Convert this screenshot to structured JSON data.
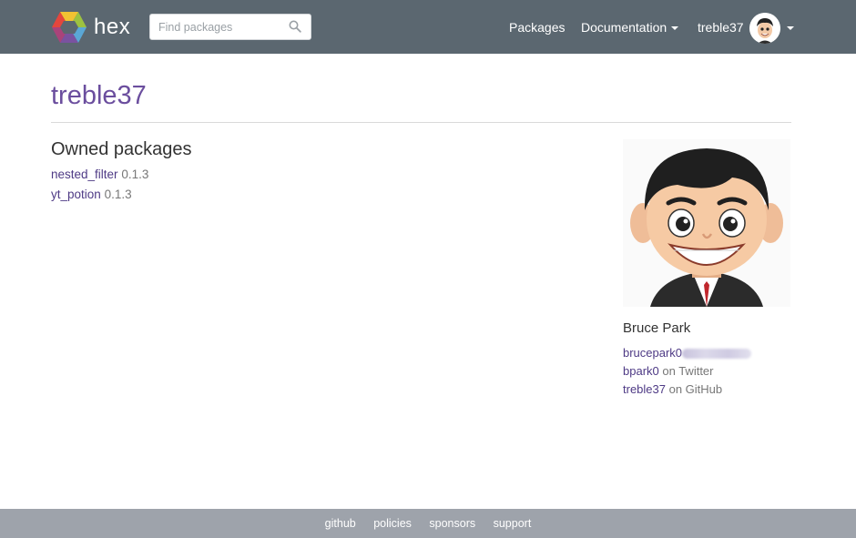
{
  "navbar": {
    "brand_name": "hex",
    "search_placeholder": "Find packages",
    "links": {
      "packages": "Packages",
      "documentation": "Documentation",
      "username": "treble37"
    }
  },
  "page": {
    "title": "treble37",
    "owned_packages_heading": "Owned packages",
    "packages": [
      {
        "name": "nested_filter",
        "version": "0.1.3"
      },
      {
        "name": "yt_potion",
        "version": "0.1.3"
      }
    ]
  },
  "profile": {
    "full_name": "Bruce Park",
    "email_visible_part": "brucepark0",
    "twitter_handle": "bpark0",
    "twitter_suffix": "on Twitter",
    "github_handle": "treble37",
    "github_suffix": "on GitHub"
  },
  "footer": {
    "links": [
      "github",
      "policies",
      "sponsors",
      "support"
    ]
  },
  "colors": {
    "navbar_bg": "#5b6770",
    "accent_purple": "#6b4e9e",
    "link_purple": "#4e3a85",
    "footer_bg": "#9ea3ab"
  }
}
